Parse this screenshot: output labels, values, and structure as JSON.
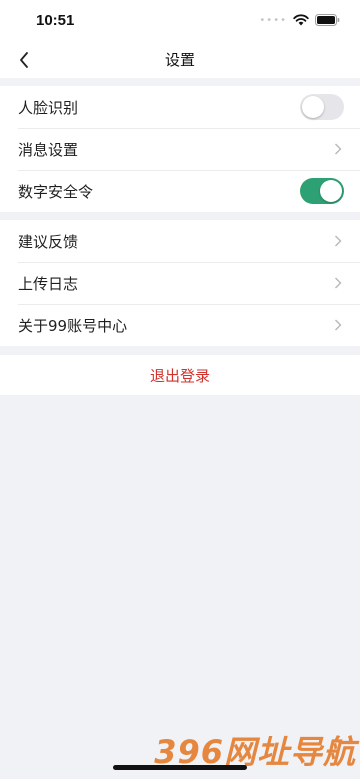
{
  "status_bar": {
    "time": "10:51",
    "dots": "••••"
  },
  "nav": {
    "title": "设置"
  },
  "section1": {
    "items": [
      {
        "label": "人脸识别",
        "control": "toggle",
        "on": false
      },
      {
        "label": "消息设置",
        "control": "chevron"
      },
      {
        "label": "数字安全令",
        "control": "toggle",
        "on": true
      }
    ]
  },
  "section2": {
    "items": [
      {
        "label": "建议反馈",
        "control": "chevron"
      },
      {
        "label": "上传日志",
        "control": "chevron"
      },
      {
        "label": "关于99账号中心",
        "control": "chevron"
      }
    ]
  },
  "logout": {
    "label": "退出登录"
  },
  "watermark": {
    "text": "396网址导航"
  },
  "colors": {
    "toggle_on": "#2da173",
    "logout": "#d2322d",
    "background": "#f1f2f6"
  }
}
